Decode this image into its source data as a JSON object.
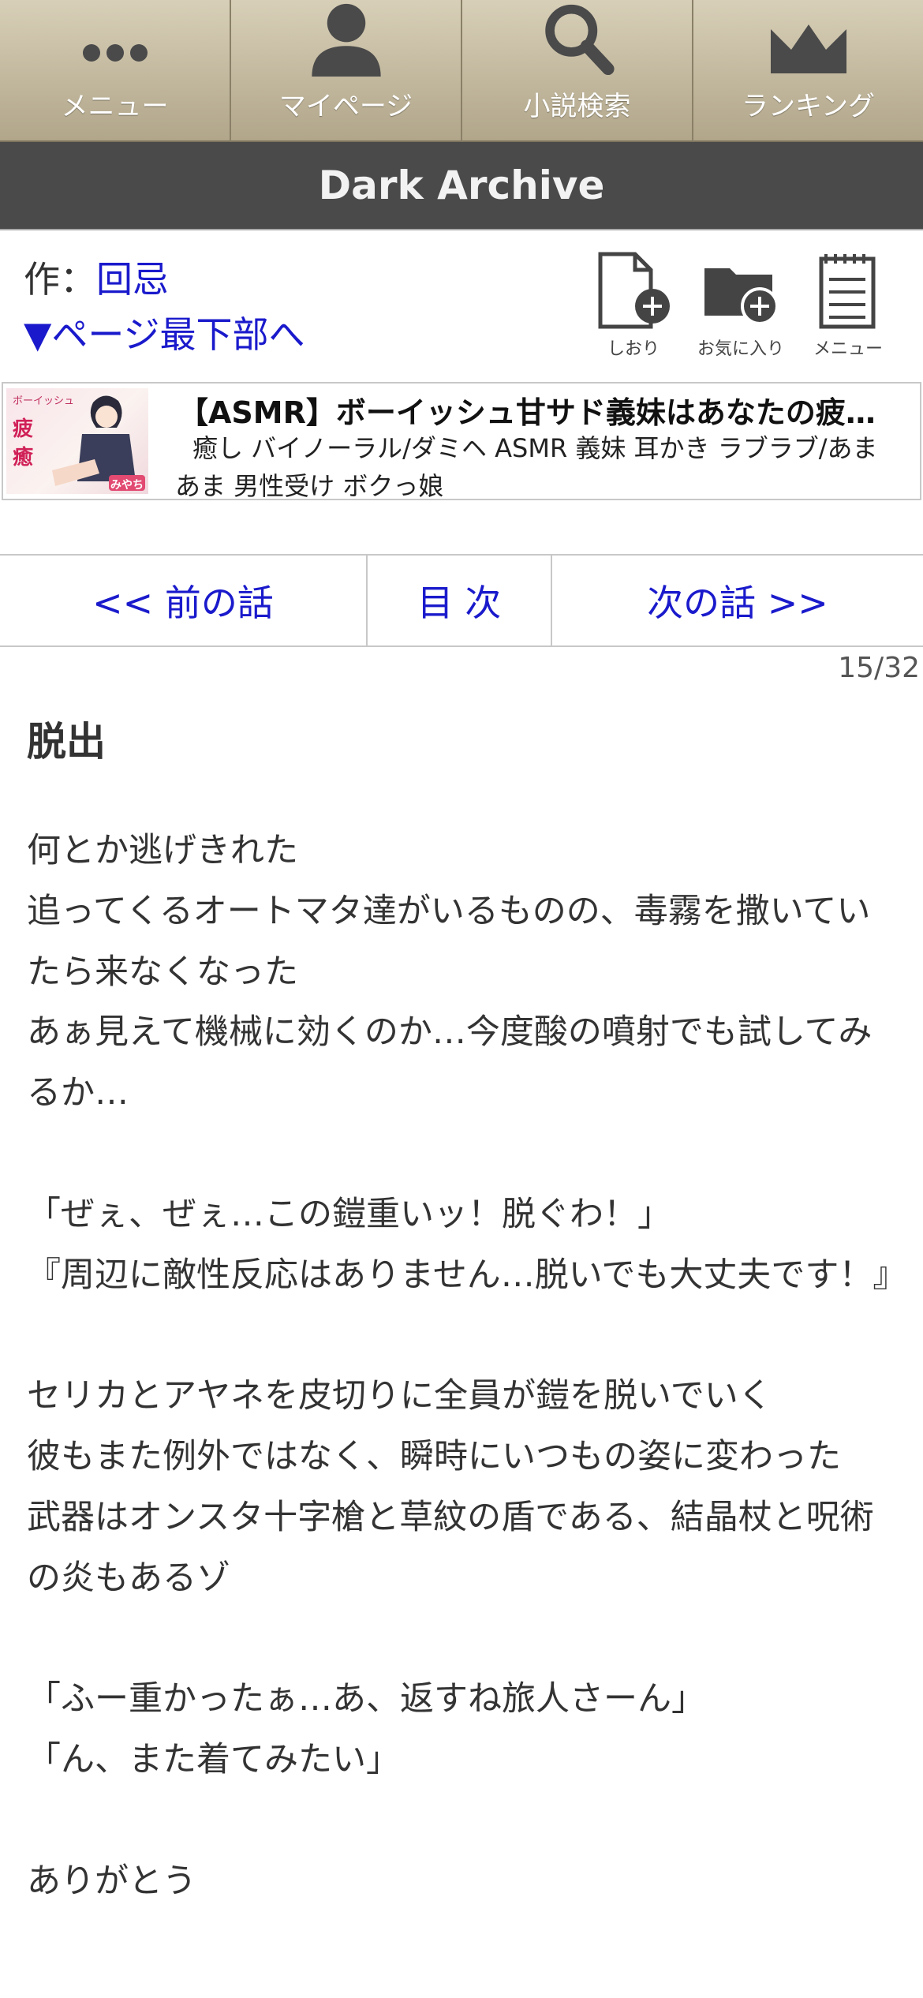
{
  "nav": {
    "items": [
      {
        "label": "メニュー",
        "icon": "dots-icon"
      },
      {
        "label": "マイページ",
        "icon": "user-icon"
      },
      {
        "label": "小説検索",
        "icon": "search-icon"
      },
      {
        "label": "ランキング",
        "icon": "crown-icon"
      }
    ]
  },
  "site": {
    "title": "Dark Archive"
  },
  "author": {
    "prefix": "作：",
    "name": "回忌"
  },
  "jump_link": "▼ページ最下部へ",
  "tools": [
    {
      "label": "しおり",
      "icon": "bookmark-add-icon"
    },
    {
      "label": "お気に入り",
      "icon": "folder-add-icon"
    },
    {
      "label": "メニュー",
      "icon": "notepad-icon"
    }
  ],
  "ad": {
    "title": "【ASMR】ボーイッシュ甘サド義妹はあなたの疲れた心を癒したい",
    "tags": "癒し バイノーラル/ダミヘ ASMR 義妹 耳かき ラブラブ/あまあま 男性受け ボクっ娘",
    "thumb_caption": "みやち"
  },
  "chapter_nav": {
    "prev": "<< 前の話",
    "toc": "目 次",
    "next": "次の話 >>"
  },
  "page_count": "15/32",
  "chapter_title": "脱出",
  "lines": [
    "何とか逃げきれた",
    "追ってくるオートマタ達がいるものの、毒霧を撒いていたら来なくなった",
    "あぁ見えて機械に効くのか…今度酸の噴射でも試してみるか…",
    "",
    "「ぜぇ、ぜぇ…この鎧重いッ！脱ぐわ！」",
    "『周辺に敵性反応はありません…脱いでも大丈夫です！』",
    "",
    "セリカとアヤネを皮切りに全員が鎧を脱いでいく",
    "彼もまた例外ではなく、瞬時にいつもの姿に変わった",
    "武器はオンスタ十字槍と草紋の盾である、結晶杖と呪術の炎もあるゾ",
    "",
    "「ふー重かったぁ…あ、返すね旅人さーん」",
    "「ん、また着てみたい」",
    "",
    "ありがとう"
  ],
  "colors": {
    "nav_bg": "#c4b99c",
    "titlebar_bg": "#4a4a4a",
    "link": "#1a1acc"
  }
}
